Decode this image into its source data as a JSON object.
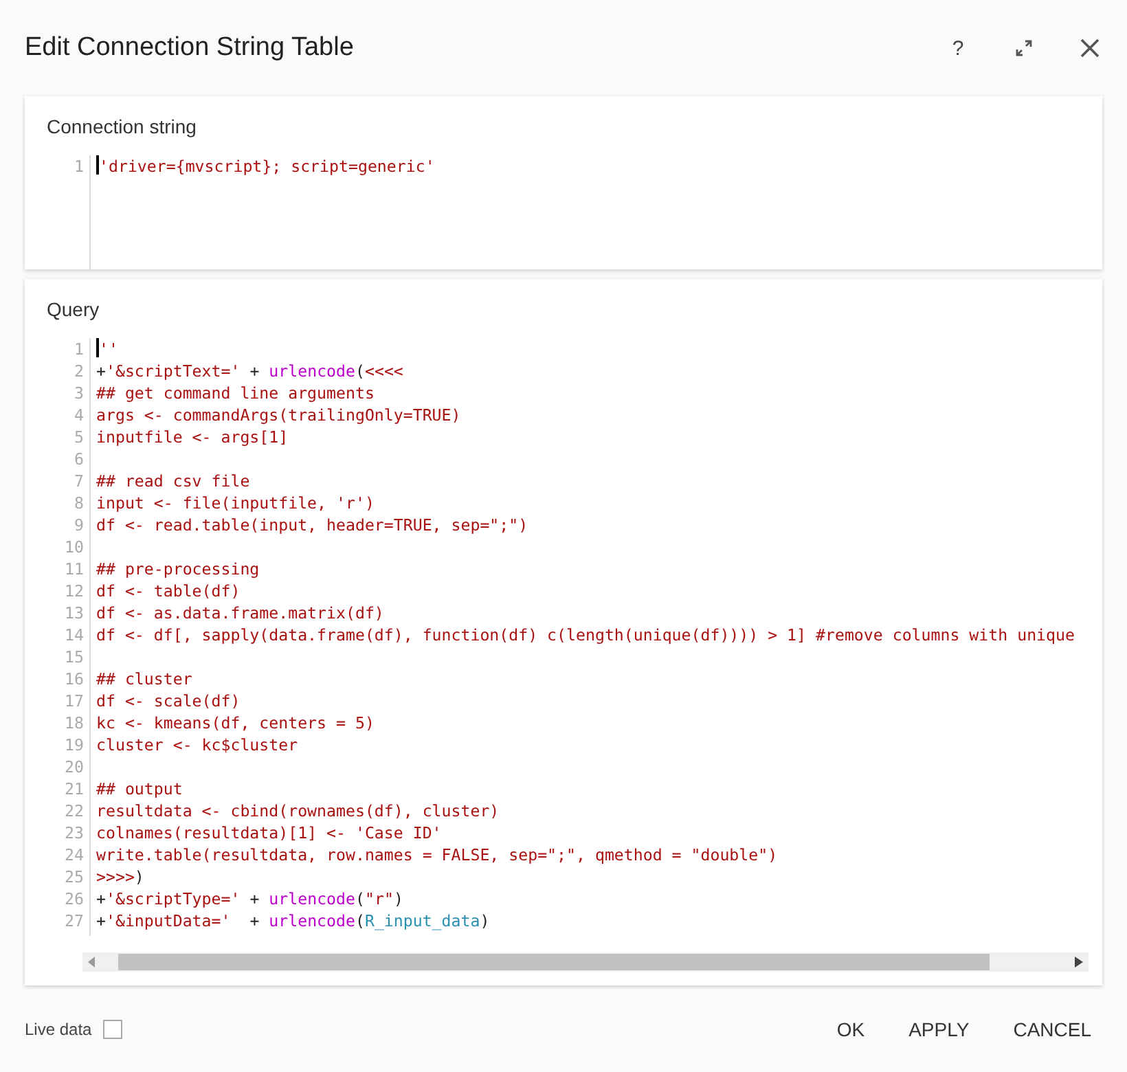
{
  "window": {
    "title": "Edit Connection String Table"
  },
  "header_buttons": [
    {
      "kind": "help",
      "label": "?"
    },
    {
      "kind": "expand"
    },
    {
      "kind": "close"
    }
  ],
  "editors": [
    {
      "label": "Connection string",
      "lines": [
        {
          "number": "1",
          "tokens": [
            {
              "kind": "str",
              "text": "'driver={mvscript}; script=generic'"
            }
          ]
        }
      ]
    },
    {
      "label": "Query",
      "scrollbar": true,
      "lines": [
        {
          "number": "1",
          "tokens": [
            {
              "kind": "str",
              "text": "''"
            }
          ]
        },
        {
          "number": "2",
          "tokens": [
            {
              "kind": "plain",
              "text": "+"
            },
            {
              "kind": "str",
              "text": "'&scriptText='"
            },
            {
              "kind": "plain",
              "text": " + "
            },
            {
              "kind": "fn",
              "text": "urlencode"
            },
            {
              "kind": "plain",
              "text": "("
            },
            {
              "kind": "str",
              "text": "<<<<"
            }
          ]
        },
        {
          "number": "3",
          "tokens": [
            {
              "kind": "str",
              "text": "## get command line arguments"
            }
          ]
        },
        {
          "number": "4",
          "tokens": [
            {
              "kind": "str",
              "text": "args <- commandArgs(trailingOnly=TRUE)"
            }
          ]
        },
        {
          "number": "5",
          "tokens": [
            {
              "kind": "str",
              "text": "inputfile <- args[1]"
            }
          ]
        },
        {
          "number": "6"
        },
        {
          "number": "7",
          "tokens": [
            {
              "kind": "str",
              "text": "## read csv file"
            }
          ]
        },
        {
          "number": "8",
          "tokens": [
            {
              "kind": "str",
              "text": "input <- file(inputfile, 'r')"
            }
          ]
        },
        {
          "number": "9",
          "tokens": [
            {
              "kind": "str",
              "text": "df <- read.table(input, header=TRUE, sep=\";\")"
            }
          ]
        },
        {
          "number": "10"
        },
        {
          "number": "11",
          "tokens": [
            {
              "kind": "str",
              "text": "## pre-processing"
            }
          ]
        },
        {
          "number": "12",
          "tokens": [
            {
              "kind": "str",
              "text": "df <- table(df)"
            }
          ]
        },
        {
          "number": "13",
          "tokens": [
            {
              "kind": "str",
              "text": "df <- as.data.frame.matrix(df)"
            }
          ]
        },
        {
          "number": "14",
          "tokens": [
            {
              "kind": "str",
              "text": "df <- df[, sapply(data.frame(df), function(df) c(length(unique(df)))) > 1] #remove columns with unique"
            }
          ]
        },
        {
          "number": "15"
        },
        {
          "number": "16",
          "tokens": [
            {
              "kind": "str",
              "text": "## cluster"
            }
          ]
        },
        {
          "number": "17",
          "tokens": [
            {
              "kind": "str",
              "text": "df <- scale(df)"
            }
          ]
        },
        {
          "number": "18",
          "tokens": [
            {
              "kind": "str",
              "text": "kc <- kmeans(df, centers = 5)"
            }
          ]
        },
        {
          "number": "19",
          "tokens": [
            {
              "kind": "str",
              "text": "cluster <- kc$cluster"
            }
          ]
        },
        {
          "number": "20"
        },
        {
          "number": "21",
          "tokens": [
            {
              "kind": "str",
              "text": "## output"
            }
          ]
        },
        {
          "number": "22",
          "tokens": [
            {
              "kind": "str",
              "text": "resultdata <- cbind(rownames(df), cluster)"
            }
          ]
        },
        {
          "number": "23",
          "tokens": [
            {
              "kind": "str",
              "text": "colnames(resultdata)[1] <- 'Case ID'"
            }
          ]
        },
        {
          "number": "24",
          "tokens": [
            {
              "kind": "str",
              "text": "write.table(resultdata, row.names = FALSE, sep=\";\", qmethod = \"double\")"
            }
          ]
        },
        {
          "number": "25",
          "tokens": [
            {
              "kind": "str",
              "text": ">>>>"
            },
            {
              "kind": "plain",
              "text": ")"
            }
          ]
        },
        {
          "number": "26",
          "tokens": [
            {
              "kind": "plain",
              "text": "+"
            },
            {
              "kind": "str",
              "text": "'&scriptType='"
            },
            {
              "kind": "plain",
              "text": " + "
            },
            {
              "kind": "fn",
              "text": "urlencode"
            },
            {
              "kind": "plain",
              "text": "("
            },
            {
              "kind": "str",
              "text": "\"r\""
            },
            {
              "kind": "plain",
              "text": ")"
            }
          ]
        },
        {
          "number": "27",
          "tokens": [
            {
              "kind": "plain",
              "text": "+"
            },
            {
              "kind": "str",
              "text": "'&inputData='"
            },
            {
              "kind": "plain",
              "text": "  + "
            },
            {
              "kind": "fn",
              "text": "urlencode"
            },
            {
              "kind": "plain",
              "text": "("
            },
            {
              "kind": "var",
              "text": "R_input_data"
            },
            {
              "kind": "plain",
              "text": ")"
            }
          ]
        }
      ]
    }
  ],
  "live_data": {
    "label": "Live data",
    "checked": false
  },
  "buttons": [
    "OK",
    "APPLY",
    "CANCEL"
  ]
}
